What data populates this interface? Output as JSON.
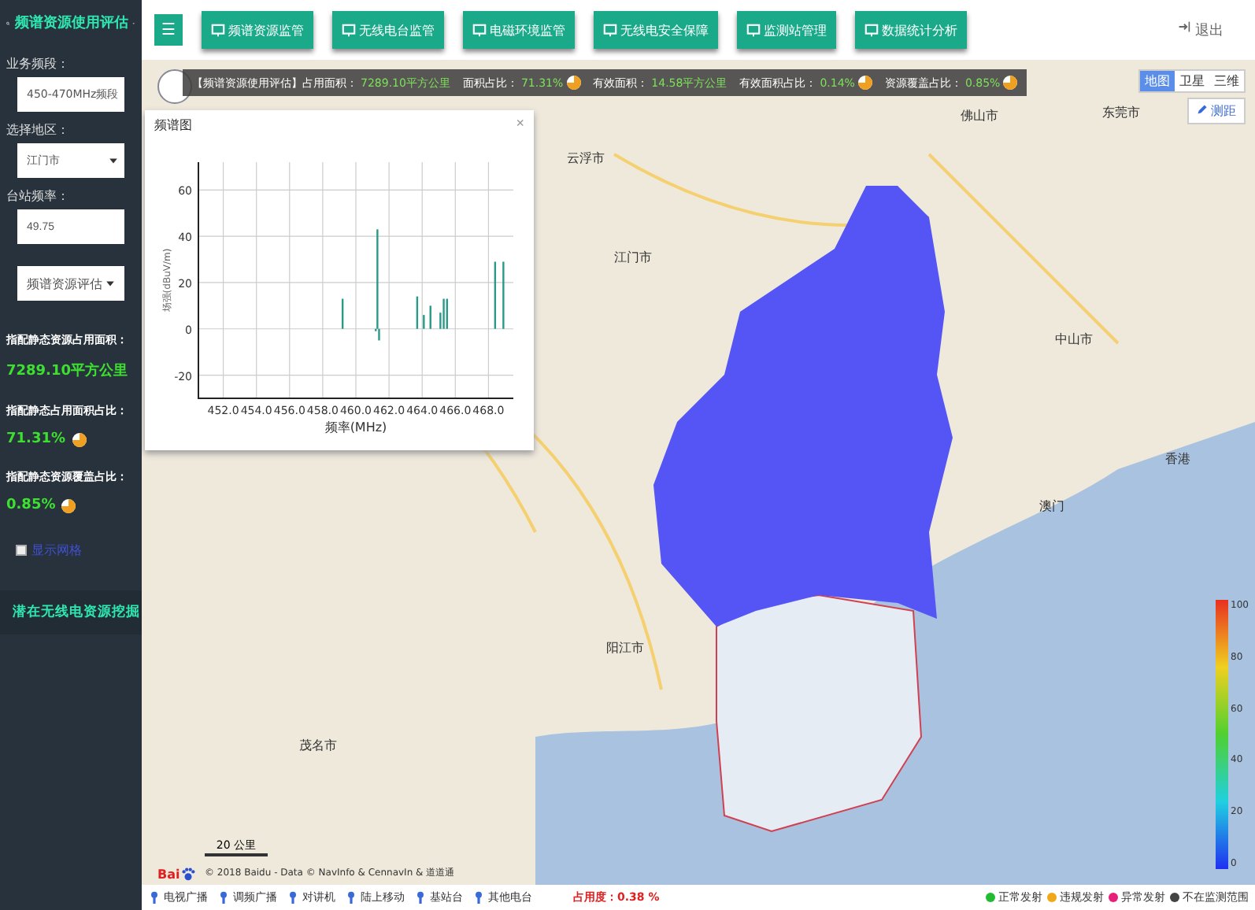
{
  "sidebar": {
    "header": "频谱资源使用评估",
    "fields": [
      {
        "kind": "select",
        "label": "业务频段：",
        "value": "450-470MHz频段"
      },
      {
        "kind": "select",
        "label": "选择地区：",
        "value": "江门市"
      },
      {
        "kind": "input",
        "label": "台站频率：",
        "value": "49.75"
      }
    ],
    "action": "频谱资源评估",
    "stats": [
      {
        "label": "指配静态资源占用面积：",
        "value": "7289.10平方公里",
        "pie": false
      },
      {
        "label": "指配静态占用面积占比：",
        "value": "71.31%",
        "pie": true
      },
      {
        "label": "指配静态资源覆盖占比：",
        "value": "0.85%",
        "pie": true
      }
    ],
    "grid_toggle": {
      "label": "显示网格",
      "checked": false
    },
    "footer": "潜在无线电资源挖掘"
  },
  "toolbar": {
    "menu": "☰",
    "buttons": [
      "频谱资源监管",
      "无线电台监管",
      "电磁环境监管",
      "无线电安全保障",
      "监测站管理",
      "数据统计分析"
    ],
    "logout": "退出"
  },
  "map": {
    "info": [
      {
        "label": "【频谱资源使用评估】占用面积：",
        "value": "7289.10平方公里",
        "pie": false
      },
      {
        "label": "面积占比：",
        "value": "71.31%",
        "pie": true
      },
      {
        "label": "有效面积：",
        "value": "14.58平方公里",
        "pie": false
      },
      {
        "label": "有效面积占比：",
        "value": "0.14%",
        "pie": true
      },
      {
        "label": "资源覆盖占比：",
        "value": "0.85%",
        "pie": true
      }
    ],
    "map_types": [
      {
        "label": "地图",
        "selected": true
      },
      {
        "label": "卫星",
        "selected": false
      },
      {
        "label": "三维",
        "selected": false
      }
    ],
    "measure": "测距",
    "places": [
      "佛山市",
      "东莞市",
      "云浮市",
      "中山市",
      "江门市",
      "阳江市",
      "茂名市",
      "澳门",
      "香港"
    ],
    "scale": "20 公里",
    "logo": "Bai",
    "copyright": "© 2018 Baidu - Data © NavInfo & CennavIn & 道道通",
    "color_scale": [
      "100",
      "80",
      "60",
      "40",
      "20",
      "0"
    ]
  },
  "chart_panel": {
    "title": "频谱图",
    "close": "×",
    "chart_data": {
      "type": "bar",
      "xlabel": "频率(MHz)",
      "ylabel": "场强(dBuV/m)",
      "grid": true,
      "x": [
        459.2,
        461.2,
        461.3,
        461.4,
        463.7,
        464.1,
        464.5,
        465.1,
        465.3,
        465.5,
        468.4,
        468.9
      ],
      "values": [
        13,
        -1,
        43,
        -5,
        14,
        6,
        10,
        7,
        13,
        13,
        29,
        29
      ],
      "xlim": [
        450.5,
        469.5
      ],
      "ylim": [
        -30,
        72
      ],
      "xticks": [
        {
          "value": 452,
          "label": "452.0"
        },
        {
          "value": 454,
          "label": "454.0"
        },
        {
          "value": 456,
          "label": "456.0"
        },
        {
          "value": 458,
          "label": "458.0"
        },
        {
          "value": 460,
          "label": "460.0"
        },
        {
          "value": 462,
          "label": "462.0"
        },
        {
          "value": 464,
          "label": "464.0"
        },
        {
          "value": 466,
          "label": "466.0"
        },
        {
          "value": 468,
          "label": "468.0"
        }
      ],
      "yticks": [
        -20,
        0,
        20,
        40,
        60
      ]
    }
  },
  "bottom_legend": {
    "items": [
      "电视广播",
      "调频广播",
      "对讲机",
      "陆上移动",
      "基站台",
      "其他电台"
    ],
    "occupancy_label": "占用度：",
    "occupancy": "0.38 %"
  },
  "status_legend": [
    {
      "label": "正常发射",
      "color": "#22bb33"
    },
    {
      "label": "违规发射",
      "color": "#f0a818"
    },
    {
      "label": "异常发射",
      "color": "#e8207a"
    },
    {
      "label": "不在监测范围",
      "color": "#444444"
    }
  ]
}
